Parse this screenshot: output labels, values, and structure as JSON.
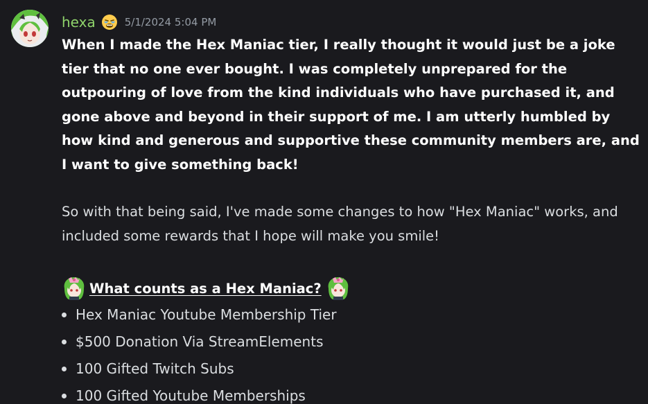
{
  "message": {
    "username": "hexa",
    "role_icon": "tired-face-emoji",
    "timestamp": "5/1/2024 5:04 PM",
    "bold_paragraph": "When I made the Hex Maniac tier, I really thought it would just be a joke tier that no one ever bought. I was completely unprepared for the outpouring of love from the kind individuals who have purchased it, and gone above and beyond in their support of me. I am utterly humbled by how kind and generous and supportive these community members are, and I want to give something back!",
    "paragraph": "So with that being said, I've made some changes to how \"Hex Maniac\" works, and included some rewards that I hope will make you smile!",
    "heading": "What counts as a Hex Maniac?",
    "heading_emoji": "hexa-chibi-emoji",
    "list_items": [
      "Hex Maniac Youtube Membership Tier",
      "$500 Donation Via StreamElements",
      "100 Gifted Twitch Subs",
      "100 Gifted Youtube Memberships"
    ]
  },
  "colors": {
    "background": "#1a1a1e",
    "username": "#8fd36b",
    "timestamp": "#949ba4",
    "text": "#dbdee1",
    "bold_text": "#ffffff"
  }
}
